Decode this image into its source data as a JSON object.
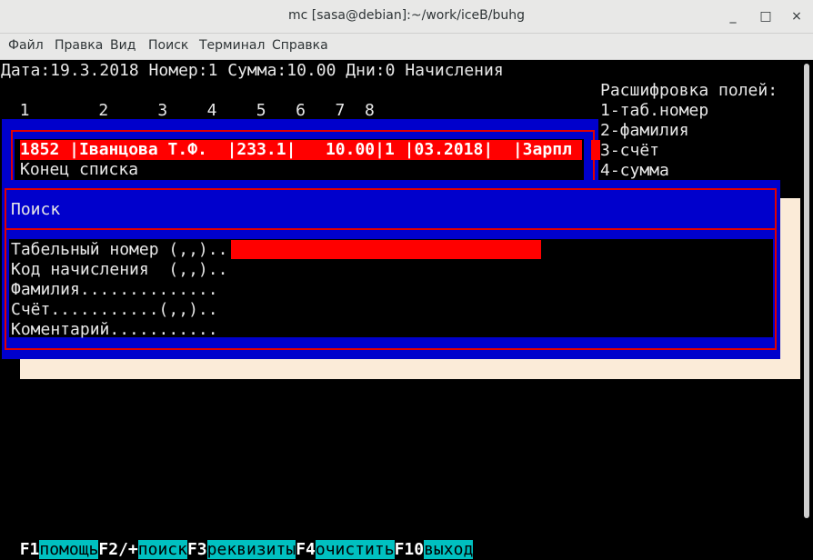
{
  "window": {
    "title": "mc [sasa@debian]:~/work/iceB/buhg",
    "minimize": "_",
    "maximize": "□",
    "close": "×"
  },
  "menu": [
    "Файл",
    "Правка",
    "Вид",
    "Поиск",
    "Терминал",
    "Справка"
  ],
  "header_line": "Дата:19.3.2018 Номер:1 Сумма:10.00 Дни:0 Начисления",
  "column_numbers": "  1       2     3    4    5   6   7  8",
  "legend": {
    "title": "Расшифровка полей:",
    "items": [
      "1-таб.номер",
      "2-фамилия",
      "3-счёт",
      "4-сумма"
    ]
  },
  "list": {
    "selected_row": "1852 |Іванцова Т.Ф.  |233.1|   10.00|1 |03.2018|  |Зарпл",
    "end": "Конец списка"
  },
  "search": {
    "title": "Поиск",
    "fields": [
      "Табельный номер (,,)..",
      "Код начисления  (,,)..",
      "Фамилия..............",
      "Счёт...........(,,)..",
      "Коментарий..........."
    ]
  },
  "fkeys": [
    {
      "key": "F1",
      "label": "помощь"
    },
    {
      "key": "F2/+",
      "label": "поиск"
    },
    {
      "key": "F3",
      "label": "реквизиты"
    },
    {
      "key": "F4",
      "label": "очистить"
    },
    {
      "key": "F10",
      "label": "выход"
    }
  ]
}
